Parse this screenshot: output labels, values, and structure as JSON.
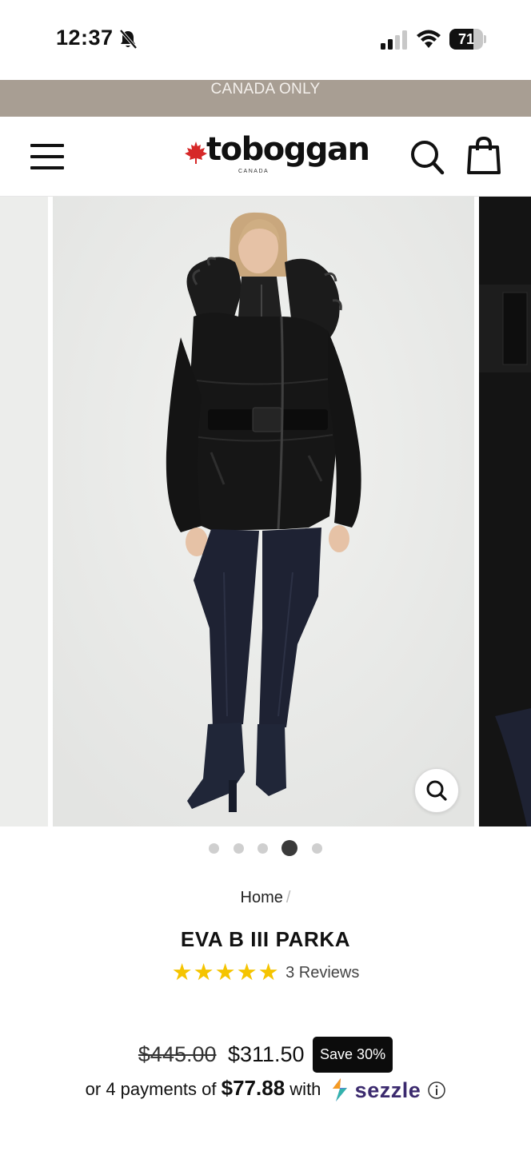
{
  "status_bar": {
    "time": "12:37",
    "battery": "71",
    "battery_level": 0.71
  },
  "promo": {
    "text": "CANADA ONLY"
  },
  "header": {
    "logo_text": "toboggan",
    "logo_subtext": "CANADA",
    "icons": {
      "menu": "hamburger-menu-icon",
      "search": "search-icon",
      "cart": "shopping-bag-icon",
      "logo_leaf": "maple-leaf-icon"
    },
    "brand_color": "#d62828"
  },
  "gallery": {
    "slide_count": 5,
    "active_index": 3,
    "zoom_icon": "magnifier-icon"
  },
  "product": {
    "breadcrumb_home": "Home",
    "breadcrumb_sep": "/",
    "title": "EVA B III PARKA",
    "rating": 5,
    "reviews": "3 Reviews",
    "price_old": "$445.00",
    "price_new": "$311.50",
    "save_badge": "Save 30%",
    "installment_prefix": "or 4 payments of",
    "installment_amount": "$77.88",
    "installment_suffix": "with",
    "sezzle_label": "sezzle"
  },
  "colors": {
    "promo_bg": "#a89e93",
    "star": "#f5c400",
    "sezzle": "#3b2a6e"
  }
}
